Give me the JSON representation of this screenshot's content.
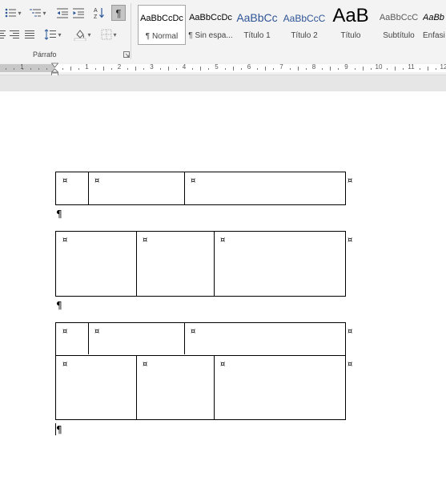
{
  "ribbon": {
    "paragraph_group_label": "Párrafo",
    "sort_label": "A↓Z",
    "show_marks_glyph": "¶",
    "styles": [
      {
        "preview": "AaBbCcDc",
        "name": "¶ Normal",
        "selected": true
      },
      {
        "preview": "AaBbCcDc",
        "name": "¶ Sin espa..."
      },
      {
        "preview": "AaBbCc",
        "name": "Título 1",
        "color": "#2f5496"
      },
      {
        "preview": "AaBbCcC",
        "name": "Título 2",
        "color": "#2f5496"
      },
      {
        "preview": "AaB",
        "name": "Título"
      },
      {
        "preview": "AaBbCcC",
        "name": "Subtítulo",
        "color": "#595959"
      },
      {
        "preview": "AaBb",
        "name": "Énfasi"
      }
    ]
  },
  "ruler": {
    "numbers": [
      "1",
      "2",
      "3",
      "4",
      "5",
      "6",
      "7",
      "8",
      "9",
      "10",
      "11",
      "12"
    ]
  },
  "document": {
    "cell_mark": "¤",
    "pilcrow": "¶"
  }
}
